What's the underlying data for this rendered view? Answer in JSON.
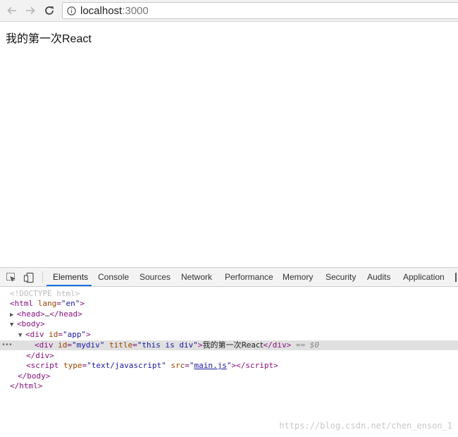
{
  "browser": {
    "url_host": "localhost",
    "url_port": ":3000"
  },
  "page": {
    "content_text": "我的第一次React"
  },
  "devtools": {
    "tabs": [
      "Elements",
      "Console",
      "Sources",
      "Network",
      "Performance",
      "Memory",
      "Security",
      "Audits",
      "Application"
    ],
    "active_tab": "Elements",
    "dom": {
      "doctype": "<!DOCTYPE html>",
      "html_open_tag": "html",
      "html_attr_name": "lang",
      "html_attr_value": "en",
      "head_tag": "head",
      "head_ellipsis": "…",
      "body_tag": "body",
      "app_div_tag": "div",
      "app_div_attr_name": "id",
      "app_div_attr_value": "app",
      "mydiv_tag": "div",
      "mydiv_id_attr": "id",
      "mydiv_id_value": "mydiv",
      "mydiv_title_attr": "title",
      "mydiv_title_value": "this is div",
      "mydiv_text": "我的第一次React",
      "selected_marker": "== $0",
      "script_tag": "script",
      "script_type_attr": "type",
      "script_type_value": "text/javascript",
      "script_src_attr": "src",
      "script_src_value": "main.js",
      "gutter_dots": "•••"
    }
  },
  "watermark": "https://blog.csdn.net/chen_enson_1",
  "colors": {
    "tag": "#881280",
    "attr_name": "#994500",
    "attr_value": "#1a1aa6",
    "active_tab_underline": "#1a73e8",
    "selected_row_bg": "#e0e0e0"
  }
}
